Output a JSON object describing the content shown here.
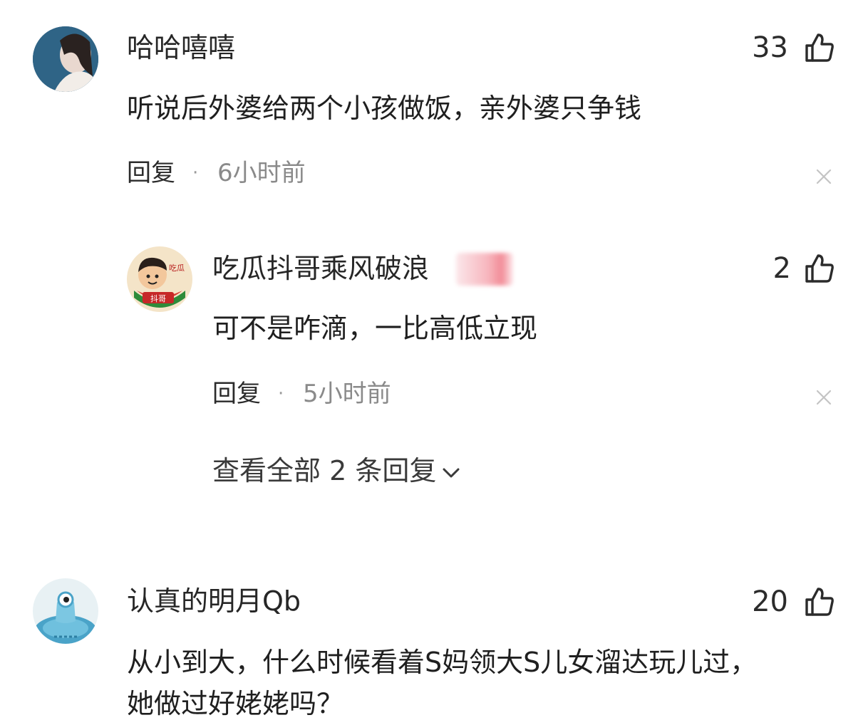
{
  "comments": [
    {
      "username": "哈哈嘻嘻",
      "text": "听说后外婆给两个小孩做饭，亲外婆只争钱",
      "likes": "33",
      "reply_label": "回复",
      "dot": "·",
      "time": "6小时前"
    },
    {
      "username": "认真的明月Qb",
      "text_line1": "从小到大，什么时候看着S妈领大S儿女溜达玩儿过，",
      "text_line2": "她做过好姥姥吗？",
      "likes": "20"
    }
  ],
  "reply": {
    "username": "吃瓜抖哥乘风破浪",
    "avatar_text_top": "吃瓜",
    "avatar_text_bottom": "抖哥",
    "text": "可不是咋滴，一比高低立现",
    "likes": "2",
    "reply_label": "回复",
    "dot": "·",
    "time": "5小时前"
  },
  "view_all": {
    "label": "查看全部 2 条回复",
    "icon": "chevron-down-icon"
  },
  "icons": {
    "like": "thumbs-up-icon",
    "close": "close-icon"
  },
  "colors": {
    "text": "#222222",
    "secondary": "#8a8a8a",
    "icon": "#2b2b2b",
    "close": "#c4c4c4"
  }
}
